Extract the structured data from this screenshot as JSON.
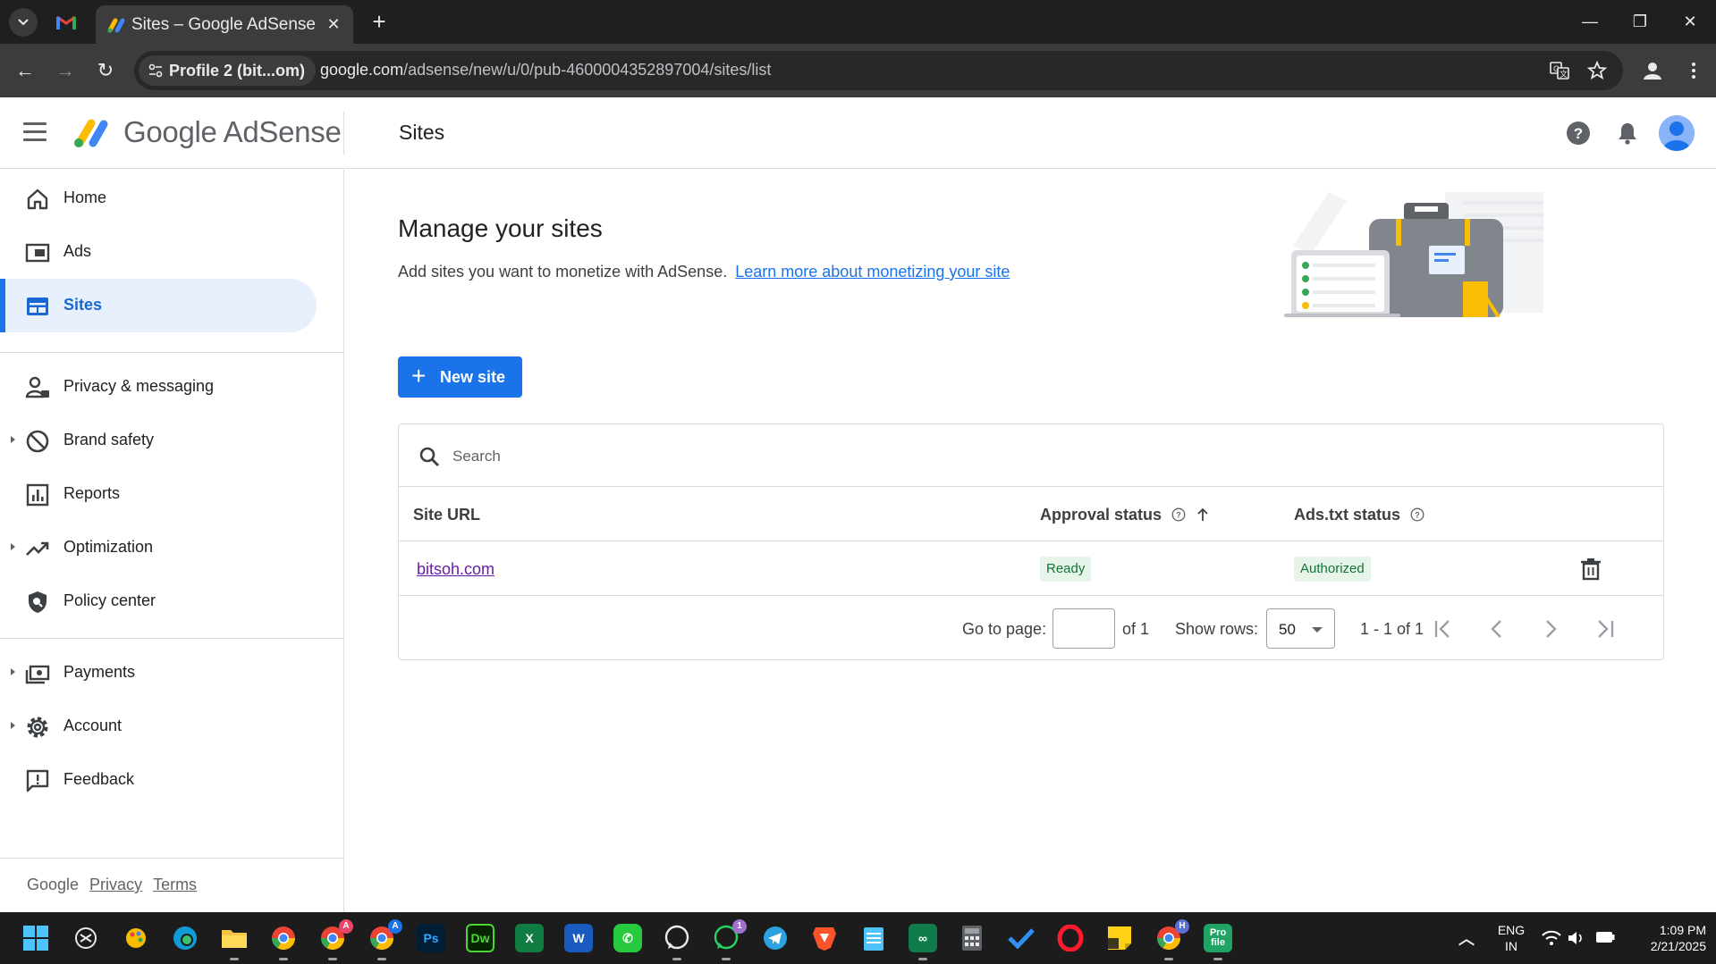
{
  "browser": {
    "tab_title": "Sites – Google AdSense",
    "profile_chip": "Profile 2 (bit...om)",
    "url_host": "google.com",
    "url_path": "/adsense/new/u/0/pub-4600004352897004/sites/list"
  },
  "header": {
    "logo_text": "Google AdSense",
    "page_title": "Sites"
  },
  "sidebar": {
    "items": [
      {
        "label": "Home",
        "icon": "home-icon",
        "expandable": false,
        "active": false
      },
      {
        "label": "Ads",
        "icon": "ads-icon",
        "expandable": false,
        "active": false
      },
      {
        "label": "Sites",
        "icon": "sites-icon",
        "expandable": false,
        "active": true
      },
      {
        "label": "Privacy & messaging",
        "icon": "privacy-icon",
        "expandable": false,
        "active": false
      },
      {
        "label": "Brand safety",
        "icon": "block-icon",
        "expandable": true,
        "active": false
      },
      {
        "label": "Reports",
        "icon": "bar-chart-icon",
        "expandable": false,
        "active": false
      },
      {
        "label": "Optimization",
        "icon": "trending-up-icon",
        "expandable": true,
        "active": false
      },
      {
        "label": "Policy center",
        "icon": "policy-icon",
        "expandable": false,
        "active": false
      },
      {
        "label": "Payments",
        "icon": "payments-icon",
        "expandable": true,
        "active": false
      },
      {
        "label": "Account",
        "icon": "gear-icon",
        "expandable": true,
        "active": false
      },
      {
        "label": "Feedback",
        "icon": "feedback-icon",
        "expandable": false,
        "active": false
      }
    ],
    "footer": {
      "brand": "Google",
      "privacy": "Privacy",
      "terms": "Terms"
    }
  },
  "main": {
    "heading": "Manage your sites",
    "description": "Add sites you want to monetize with AdSense.",
    "learn_more": "Learn more about monetizing your site",
    "new_site_label": "New site",
    "search": {
      "placeholder": "Search",
      "value": ""
    },
    "table": {
      "columns": [
        "Site URL",
        "Approval status",
        "Ads.txt status"
      ],
      "rows": [
        {
          "site_url": "bitsoh.com",
          "approval_status": "Ready",
          "ads_txt_status": "Authorized"
        }
      ]
    },
    "pagination": {
      "go_to_page_label": "Go to page:",
      "page_value": "",
      "of_pages": "of 1",
      "show_rows_label": "Show rows:",
      "rows_per_page": "50",
      "range": "1 - 1 of 1"
    }
  },
  "taskbar": {
    "whatsapp_badge": "1",
    "lang_line1": "ENG",
    "lang_line2": "IN",
    "time": "1:09 PM",
    "date": "2/21/2025"
  },
  "colors": {
    "accent": "#1a73e8",
    "active_nav_bg": "#e8f0fe",
    "status_green": "#137333",
    "status_green_bg": "#e6f4ea",
    "visited_link": "#681da8"
  }
}
